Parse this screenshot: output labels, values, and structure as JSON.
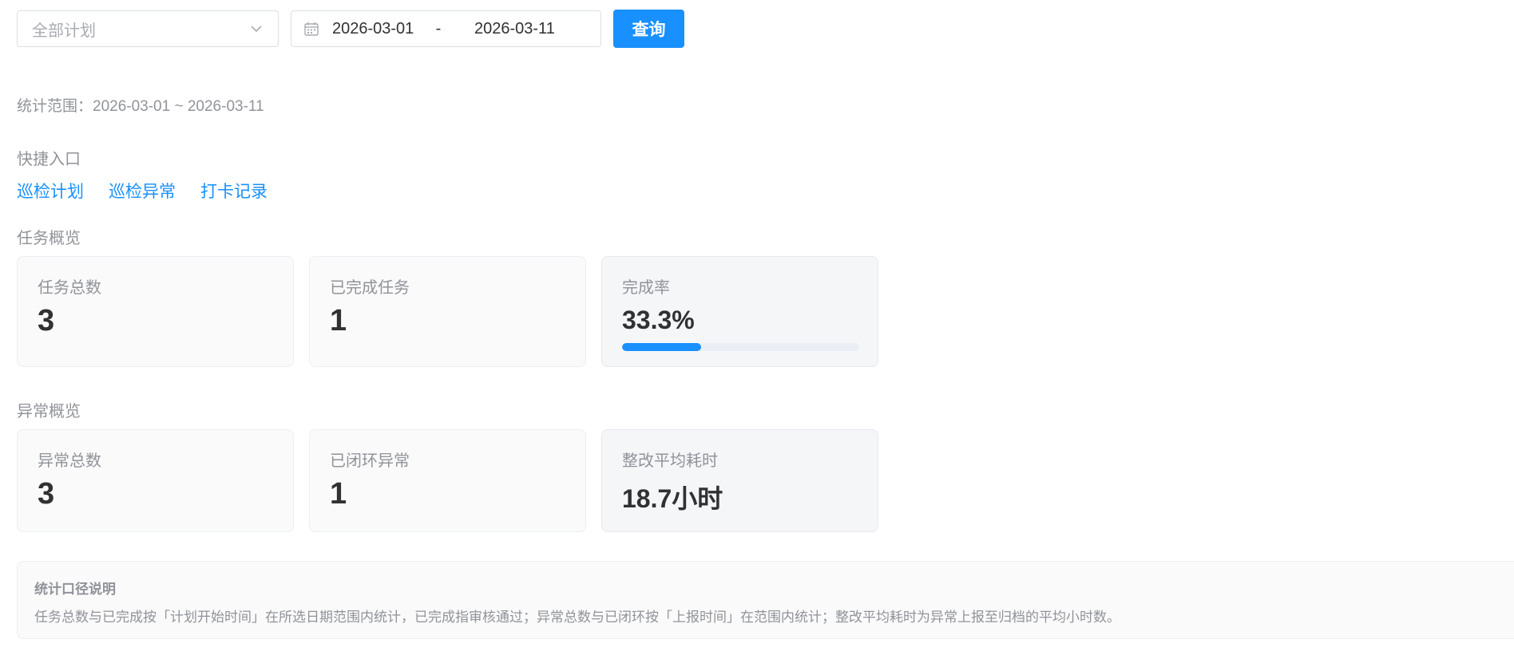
{
  "filters": {
    "plan_select_placeholder": "全部计划",
    "date_start": "2026-03-01",
    "date_separator": "-",
    "date_end": "2026-03-11",
    "query_label": "查询"
  },
  "range": {
    "text": "统计范围：2026-03-01 ~ 2026-03-11"
  },
  "shortcuts": {
    "title": "快捷入口",
    "links": [
      "巡检计划",
      "巡检异常",
      "打卡记录"
    ]
  },
  "task_overview": {
    "title": "任务概览",
    "cards": [
      {
        "label": "任务总数",
        "value": "3"
      },
      {
        "label": "已完成任务",
        "value": "1"
      },
      {
        "label": "完成率",
        "value": "33.3%",
        "progress_percent": 33.3
      }
    ]
  },
  "issue_overview": {
    "title": "异常概览",
    "cards": [
      {
        "label": "异常总数",
        "value": "3"
      },
      {
        "label": "已闭环异常",
        "value": "1"
      },
      {
        "label": "整改平均耗时",
        "value": "18.7小时"
      }
    ]
  },
  "note": {
    "title": "统计口径说明",
    "body": "任务总数与已完成按「计划开始时间」在所选日期范围内统计，已完成指审核通过；异常总数与已闭环按「上报时间」在范围内统计；整改平均耗时为异常上报至归档的平均小时数。"
  },
  "colors": {
    "primary": "#1890ff",
    "muted_text": "#909399",
    "card_bg": "#fafafa"
  },
  "icons": {
    "select_arrow": "chevron-down-icon",
    "date": "calendar-icon"
  }
}
